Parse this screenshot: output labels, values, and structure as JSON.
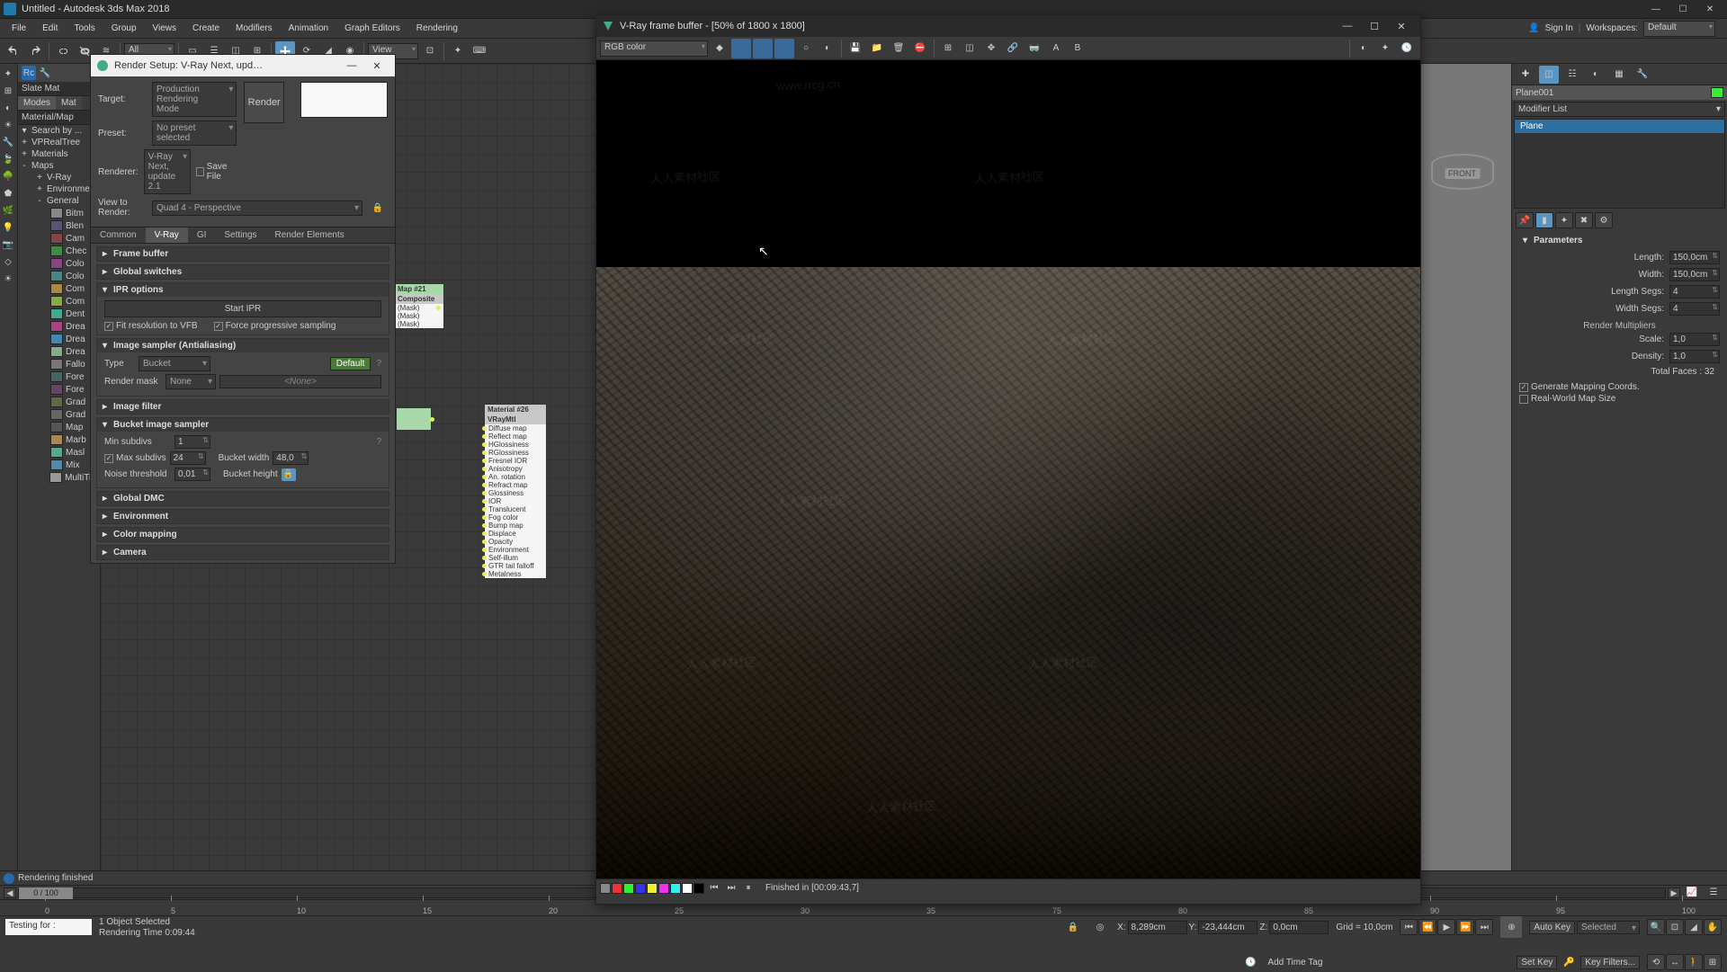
{
  "titlebar": {
    "title": "Untitled - Autodesk 3ds Max 2018"
  },
  "menubar": {
    "items": [
      "File",
      "Edit",
      "Tools",
      "Group",
      "Views",
      "Create",
      "Modifiers",
      "Animation",
      "Graph Editors",
      "Rendering"
    ],
    "signin": "Sign In",
    "workspaces_label": "Workspaces:",
    "workspaces_value": "Default"
  },
  "toolbar": {
    "all_filter": "All",
    "view_label": "View"
  },
  "maplist": {
    "header": "Material/Map",
    "search_label": "Search by ...",
    "real_tree": "VPRealTree",
    "materials": "Materials",
    "maps": "Maps",
    "vray": "V-Ray",
    "environ": "Environmen",
    "general": "General",
    "items": [
      "Bitm",
      "Blen",
      "Cam",
      "Chec",
      "Colo",
      "Colo",
      "Com",
      "Com",
      "Dent",
      "Drea",
      "Drea",
      "Drea",
      "Fallo",
      "Fore",
      "Fore",
      "Grad",
      "Grad",
      "Map",
      "Marb",
      "Masl",
      "Mix",
      "MultiTile"
    ],
    "tabs": {
      "modes": "Modes",
      "mat": "Mat"
    },
    "slate": "Slate Mat"
  },
  "render_dlg": {
    "title": "Render Setup: V-Ray Next, upd…",
    "target_label": "Target:",
    "target_value": "Production Rendering Mode",
    "preset_label": "Preset:",
    "preset_value": "No preset selected",
    "renderer_label": "Renderer:",
    "renderer_value": "V-Ray Next, update 2.1",
    "savefile": "Save File",
    "viewto_label": "View to Render:",
    "viewto_value": "Quad 4 - Perspective",
    "render_btn": "Render",
    "tabs": [
      "Common",
      "V-Ray",
      "GI",
      "Settings",
      "Render Elements"
    ],
    "rollouts": {
      "frame_buffer": "Frame buffer",
      "global_switches": "Global switches",
      "ipr_options": "IPR options",
      "start_ipr": "Start IPR",
      "fit_res": "Fit resolution to VFB",
      "force_prog": "Force progressive sampling",
      "image_sampler": "Image sampler (Antialiasing)",
      "type_label": "Type",
      "type_value": "Bucket",
      "default_btn": "Default",
      "render_mask_label": "Render mask",
      "render_mask_value": "None",
      "none_placeholder": "<None>",
      "image_filter": "Image filter",
      "bucket_sampler": "Bucket image sampler",
      "min_subdivs_label": "Min subdivs",
      "min_subdivs_value": "1",
      "max_subdivs_label": "Max subdivs",
      "max_subdivs_value": "24",
      "bucket_width_label": "Bucket width",
      "bucket_width_value": "48,0",
      "noise_thresh_label": "Noise threshold",
      "noise_thresh_value": "0,01",
      "bucket_height_label": "Bucket height",
      "global_dmc": "Global DMC",
      "environment": "Environment",
      "color_mapping": "Color mapping",
      "camera": "Camera"
    }
  },
  "vfb": {
    "title": "V-Ray frame buffer - [50% of 1800 x 1800]",
    "channel": "RGB color",
    "footer": "Finished in [00:09:43,7]"
  },
  "nodes": {
    "comp": {
      "title": "Map #21",
      "type": "Composite",
      "ports": [
        "(Mask)",
        "(Mask)",
        "(Mask)"
      ]
    },
    "mtl": {
      "title": "Material #26",
      "type": "VRayMtl",
      "ports": [
        "Diffuse map",
        "Reflect map",
        "HGlossiness",
        "RGlossiness",
        "Fresnel IOR",
        "Anisotropy",
        "An. rotation",
        "Refract map",
        "Glossiness",
        "IOR",
        "Translucent",
        "Fog color",
        "Bump map",
        "Displace",
        "Opacity",
        "Environment",
        "Self-illum",
        "GTR tail falloff",
        "Metalness"
      ]
    }
  },
  "cmd": {
    "obj_name": "Plane001",
    "modlist_label": "Modifier List",
    "modstack_item": "Plane",
    "parameters": "Parameters",
    "length_label": "Length:",
    "length_value": "150,0cm",
    "width_label": "Width:",
    "width_value": "150,0cm",
    "lsegs_label": "Length Segs:",
    "lsegs_value": "4",
    "wsegs_label": "Width Segs:",
    "wsegs_value": "4",
    "render_mult": "Render Multipliers",
    "scale_label": "Scale:",
    "scale_value": "1,0",
    "density_label": "Density:",
    "density_value": "1,0",
    "total_faces": "Total Faces : 32",
    "gen_mapping": "Generate Mapping Coords.",
    "real_world": "Real-World Map Size"
  },
  "viewport": {
    "front_label": "FRONT"
  },
  "status": {
    "msg": "Rendering finished"
  },
  "timeline": {
    "slider_text": "0 / 100",
    "marks": [
      "0",
      "5",
      "10",
      "15",
      "20",
      "25",
      "30",
      "35"
    ],
    "marks_right": [
      "75",
      "80",
      "85",
      "90",
      "95",
      "100"
    ]
  },
  "statusbar": {
    "script": "Testing for :",
    "sel": "1 Object Selected",
    "render_time": "Rendering Time  0:09:44",
    "x_label": "X:",
    "x_value": "8,289cm",
    "y_label": "Y:",
    "y_value": "-23,444cm",
    "z_label": "Z:",
    "z_value": "0,0cm",
    "grid_label": "Grid = 10,0cm",
    "auto_key": "Auto Key",
    "set_key": "Set Key",
    "selected": "Selected",
    "key_filters": "Key Filters...",
    "add_time_tag": "Add Time Tag"
  }
}
